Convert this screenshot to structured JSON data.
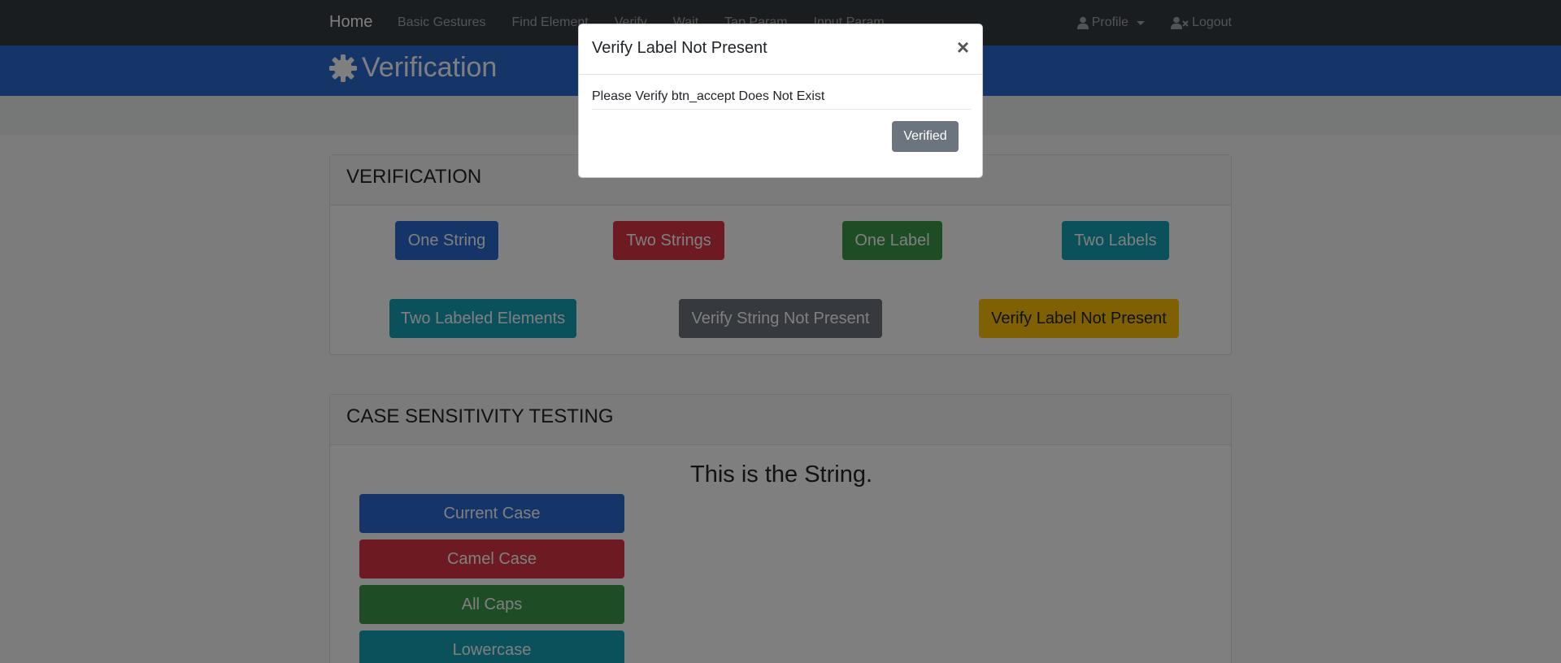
{
  "navbar": {
    "brand": "Home",
    "links": [
      "Basic Gestures",
      "Find Element",
      "Verify",
      "Wait",
      "Tap Param",
      "Input Param"
    ],
    "profile": "Profile",
    "logout": "Logout"
  },
  "header": {
    "title": "Verification"
  },
  "verification": {
    "title": "VERIFICATION",
    "buttons": [
      "One String",
      "Two Strings",
      "One Label",
      "Two Labels",
      "Two Labeled Elements",
      "Verify String Not Present",
      "Verify Label Not Present"
    ]
  },
  "case": {
    "title": "CASE SENSITIVITY TESTING",
    "string": "This is the String.",
    "buttons": [
      "Current Case",
      "Camel Case",
      "All Caps",
      "Lowercase"
    ]
  },
  "modal": {
    "title": "Verify Label Not Present",
    "close": "×",
    "body": "Please Verify btn_accept Does Not Exist",
    "button": "Verified"
  },
  "colors": {
    "navbar": "#343a40",
    "header": "#2a6ad3",
    "primary": "#2a6ad3",
    "danger": "#dc3545",
    "success": "#3d9a4a",
    "info": "#17a2b8",
    "secondary": "#6c757d",
    "warning": "#ffc107"
  }
}
